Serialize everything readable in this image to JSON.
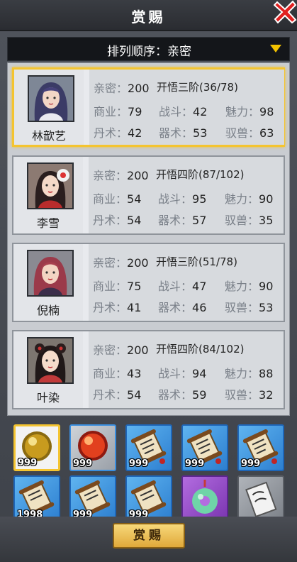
{
  "header": {
    "title": "赏赐"
  },
  "sort": {
    "label": "排列顺序：亲密"
  },
  "characters": [
    {
      "name": "林歆艺",
      "intimacy_label": "亲密：",
      "intimacy": "200",
      "stage": "开悟三阶(36/78)",
      "stats": [
        {
          "k": "商业：",
          "v": "79"
        },
        {
          "k": "战斗：",
          "v": "42"
        },
        {
          "k": "魅力：",
          "v": "98"
        },
        {
          "k": "丹术：",
          "v": "42"
        },
        {
          "k": "器术：",
          "v": "53"
        },
        {
          "k": "驭兽：",
          "v": "63"
        }
      ]
    },
    {
      "name": "李雪",
      "intimacy_label": "亲密：",
      "intimacy": "200",
      "stage": "开悟四阶(87/102)",
      "stats": [
        {
          "k": "商业：",
          "v": "54"
        },
        {
          "k": "战斗：",
          "v": "95"
        },
        {
          "k": "魅力：",
          "v": "90"
        },
        {
          "k": "丹术：",
          "v": "54"
        },
        {
          "k": "器术：",
          "v": "57"
        },
        {
          "k": "驭兽：",
          "v": "35"
        }
      ]
    },
    {
      "name": "倪楠",
      "intimacy_label": "亲密：",
      "intimacy": "200",
      "stage": "开悟三阶(51/78)",
      "stats": [
        {
          "k": "商业：",
          "v": "75"
        },
        {
          "k": "战斗：",
          "v": "47"
        },
        {
          "k": "魅力：",
          "v": "90"
        },
        {
          "k": "丹术：",
          "v": "41"
        },
        {
          "k": "器术：",
          "v": "46"
        },
        {
          "k": "驭兽：",
          "v": "53"
        }
      ]
    },
    {
      "name": "叶染",
      "intimacy_label": "亲密：",
      "intimacy": "200",
      "stage": "开悟四阶(84/102)",
      "stats": [
        {
          "k": "商业：",
          "v": "43"
        },
        {
          "k": "战斗：",
          "v": "94"
        },
        {
          "k": "魅力：",
          "v": "88"
        },
        {
          "k": "丹术：",
          "v": "54"
        },
        {
          "k": "器术：",
          "v": "59"
        },
        {
          "k": "驭兽：",
          "v": "32"
        }
      ]
    }
  ],
  "items": [
    {
      "icon": "gold-orb-icon",
      "count": "999"
    },
    {
      "icon": "red-orb-icon",
      "count": "999"
    },
    {
      "icon": "scroll-icon",
      "count": "999"
    },
    {
      "icon": "scroll-icon",
      "count": "999"
    },
    {
      "icon": "scroll-icon",
      "count": "999"
    },
    {
      "icon": "scroll-icon",
      "count": "1998"
    },
    {
      "icon": "scroll-icon",
      "count": "999"
    },
    {
      "icon": "scroll-icon",
      "count": "999"
    },
    {
      "icon": "jade-pendant-icon",
      "count": ""
    },
    {
      "icon": "paper-scroll-icon",
      "count": ""
    }
  ],
  "footer": {
    "button_label": "赏赐"
  },
  "colors": {
    "selected_border": "#f4c430",
    "button_gold": "#e0a93a",
    "close_red": "#e02020"
  }
}
